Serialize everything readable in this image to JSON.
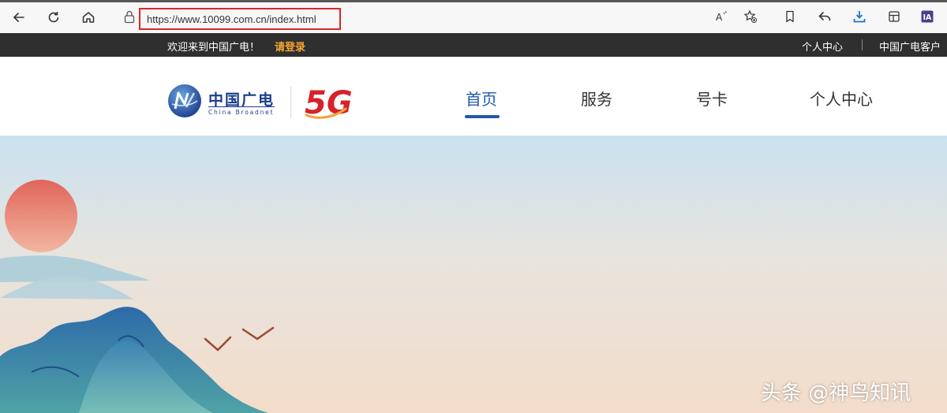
{
  "browser": {
    "url": "https://www.10099.com.cn/index.html"
  },
  "topbar": {
    "welcome": "欢迎来到中国广电！",
    "login": "请登录",
    "personal_center": "个人中心",
    "client": "中国广电客户"
  },
  "header": {
    "logo_cn": "中国广电",
    "logo_en": "China Broadnet",
    "logo_5g": "5G",
    "nav": [
      {
        "label": "首页",
        "active": true
      },
      {
        "label": "服务",
        "active": false
      },
      {
        "label": "号卡",
        "active": false
      },
      {
        "label": "个人中心",
        "active": false
      }
    ]
  },
  "watermark": "头条 @神鸟知讯",
  "icons": [
    "back-icon",
    "refresh-icon",
    "home-icon",
    "lock-icon",
    "read-aloud-icon",
    "favorite-add-icon",
    "favorites-icon",
    "share-icon",
    "download-icon",
    "collections-icon",
    "extension-icon"
  ],
  "colors": {
    "accent": "#1e5aa8",
    "login": "#f7a531",
    "url_highlight": "#d9262b"
  }
}
